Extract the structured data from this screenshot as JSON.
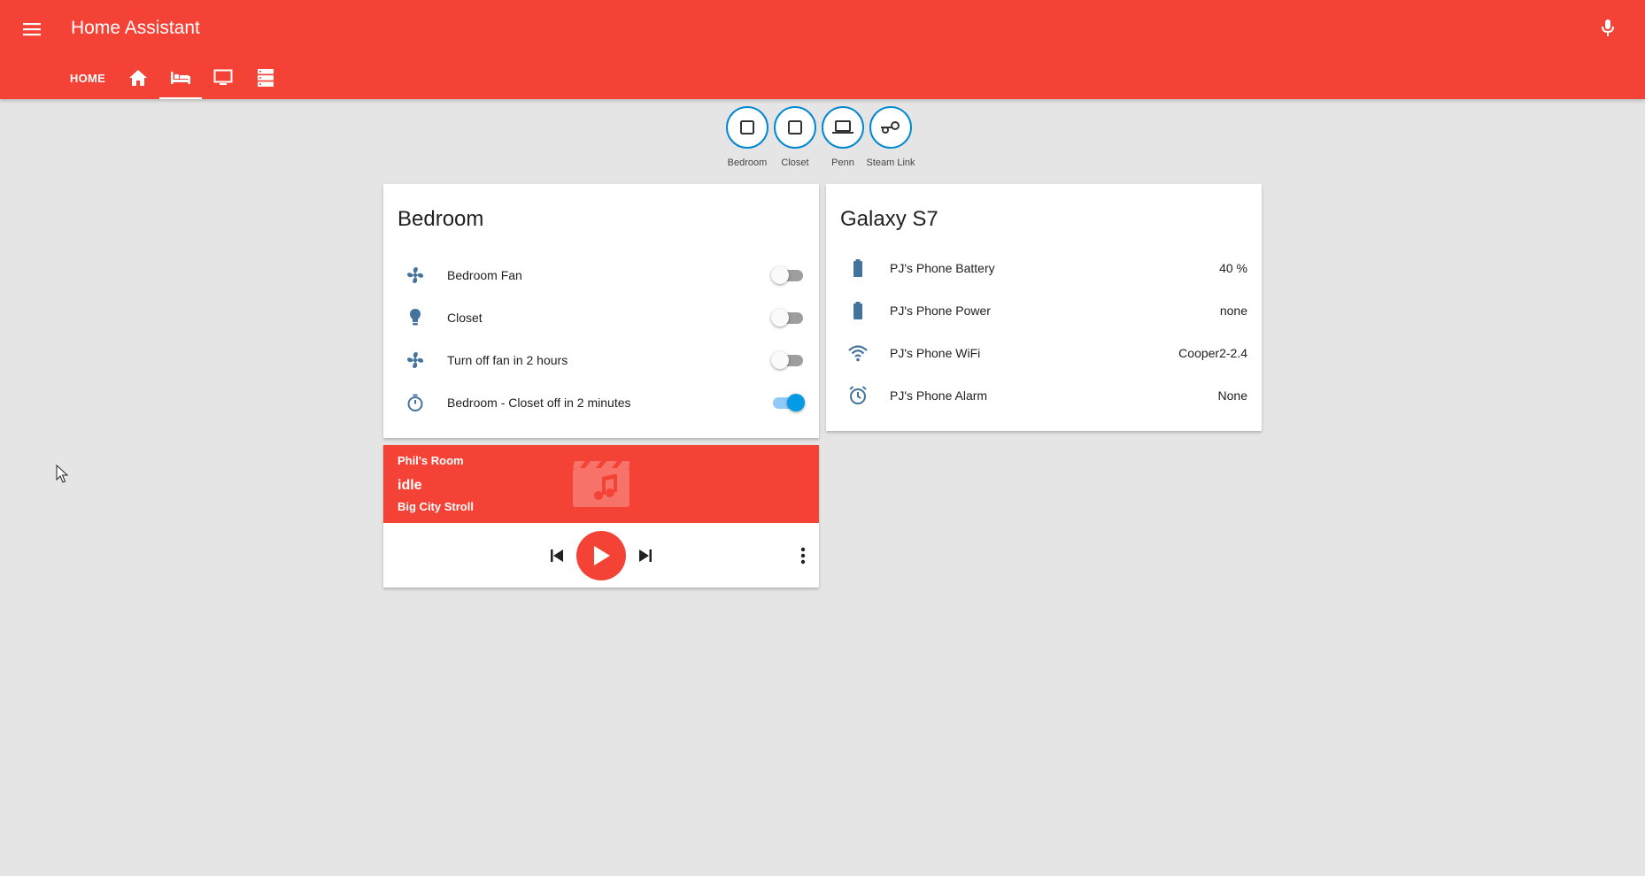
{
  "app": {
    "title": "Home Assistant"
  },
  "colors": {
    "accent": "#f44336",
    "icon_blue": "#44739e",
    "badge_blue": "#0288d1",
    "toggle_on": "#039be5"
  },
  "header": {
    "menu_icon": "menu-icon",
    "mic_icon": "microphone-icon",
    "tabs": [
      {
        "label": "HOME",
        "active": false
      },
      {
        "icon": "home-icon",
        "active": false
      },
      {
        "icon": "bed-icon",
        "active": true
      },
      {
        "icon": "monitor-icon",
        "active": false
      },
      {
        "icon": "server-icon",
        "active": false
      }
    ]
  },
  "badges": [
    {
      "label": "Bedroom",
      "icon": "checkbox-blank-outline-icon"
    },
    {
      "label": "Closet",
      "icon": "checkbox-blank-outline-icon"
    },
    {
      "label": "Penn",
      "icon": "laptop-icon"
    },
    {
      "label": "Steam Link",
      "icon": "steam-icon"
    }
  ],
  "bedroom_card": {
    "title": "Bedroom",
    "rows": [
      {
        "label": "Bedroom Fan",
        "icon": "fan-icon",
        "state": "off"
      },
      {
        "label": "Closet",
        "icon": "lightbulb-icon",
        "state": "off"
      },
      {
        "label": "Turn off fan in 2 hours",
        "icon": "fan-icon",
        "state": "off"
      },
      {
        "label": "Bedroom - Closet off in 2 minutes",
        "icon": "timer-icon",
        "state": "on"
      }
    ]
  },
  "galaxy_card": {
    "title": "Galaxy S7",
    "rows": [
      {
        "label": "PJ's Phone Battery",
        "value": "40 %",
        "icon": "battery-icon"
      },
      {
        "label": "PJ's Phone Power",
        "value": "none",
        "icon": "battery-icon"
      },
      {
        "label": "PJ's Phone WiFi",
        "value": "Cooper2-2.4",
        "icon": "wifi-icon"
      },
      {
        "label": "PJ's Phone Alarm",
        "value": "None",
        "icon": "alarm-icon"
      }
    ]
  },
  "media_card": {
    "name": "Phil's Room",
    "state": "idle",
    "track": "Big City Stroll",
    "art_icon": "music-video-icon",
    "controls": [
      "skip-previous-icon",
      "play-icon",
      "skip-next-icon",
      "more-vertical-icon"
    ]
  }
}
